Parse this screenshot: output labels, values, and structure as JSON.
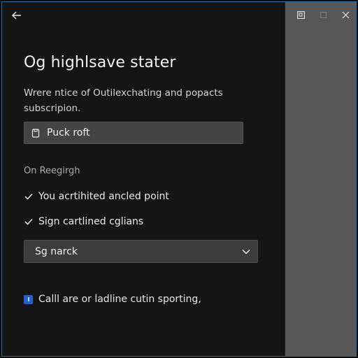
{
  "header": {
    "back_icon": "back-arrow-icon",
    "controls": [
      "restore-icon",
      "minimize-icon",
      "close-icon"
    ]
  },
  "main": {
    "title": "Og highlsave stater",
    "description_line1": "Wrere ntice of Outilexchating and popacts",
    "description_line2": "subscripion.",
    "primary_button_label": "Puck roft",
    "section_label": "On Reegirgh",
    "checks": [
      {
        "label": "You acrtihited ancled point"
      },
      {
        "label": "Sign cartlined cglians"
      }
    ],
    "select_value": "Sg narck",
    "checkbox_label": "Calll are or ladline cutin sporting,"
  },
  "colors": {
    "accent": "#1f63c7",
    "side_panel": "#575757",
    "border": "#2a6ea8"
  }
}
